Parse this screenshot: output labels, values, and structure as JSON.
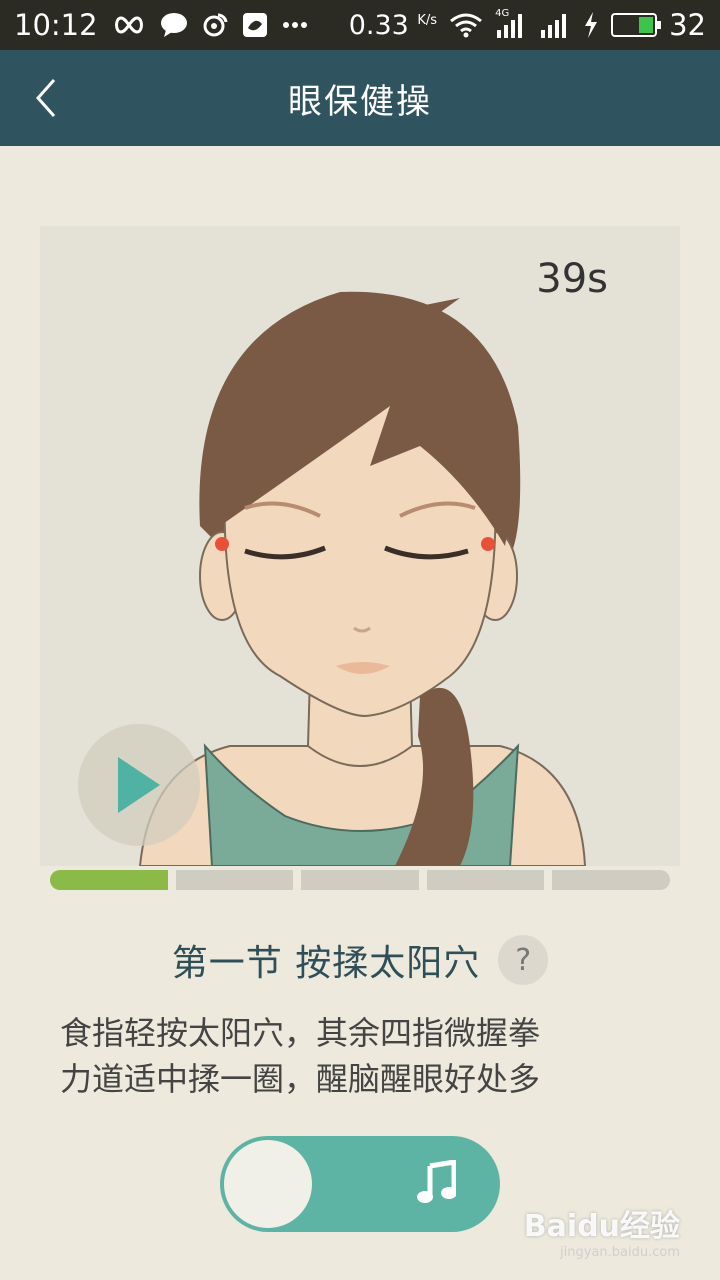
{
  "status_bar": {
    "time": "10:12",
    "speed": "0.33",
    "speed_unit": "K/s",
    "network": "4G",
    "battery": "32"
  },
  "header": {
    "title": "眼保健操"
  },
  "exercise": {
    "timer": "39s",
    "progress_total_segments": 5,
    "progress_active_segments": 1,
    "section_title": "第一节 按揉太阳穴",
    "help_label": "?",
    "description_line1": "食指轻按太阳穴，其余四指微握拳",
    "description_line2": "力道适中揉一圈，醒脑醒眼好处多"
  },
  "music_toggle": {
    "state": "off"
  },
  "watermark": {
    "brand": "Baidu经验",
    "url": "jingyan.baidu.com"
  },
  "colors": {
    "header_bg": "#2f5460",
    "accent": "#5eb4a4",
    "progress_active": "#8bba48",
    "page_bg": "#ede9dc"
  }
}
